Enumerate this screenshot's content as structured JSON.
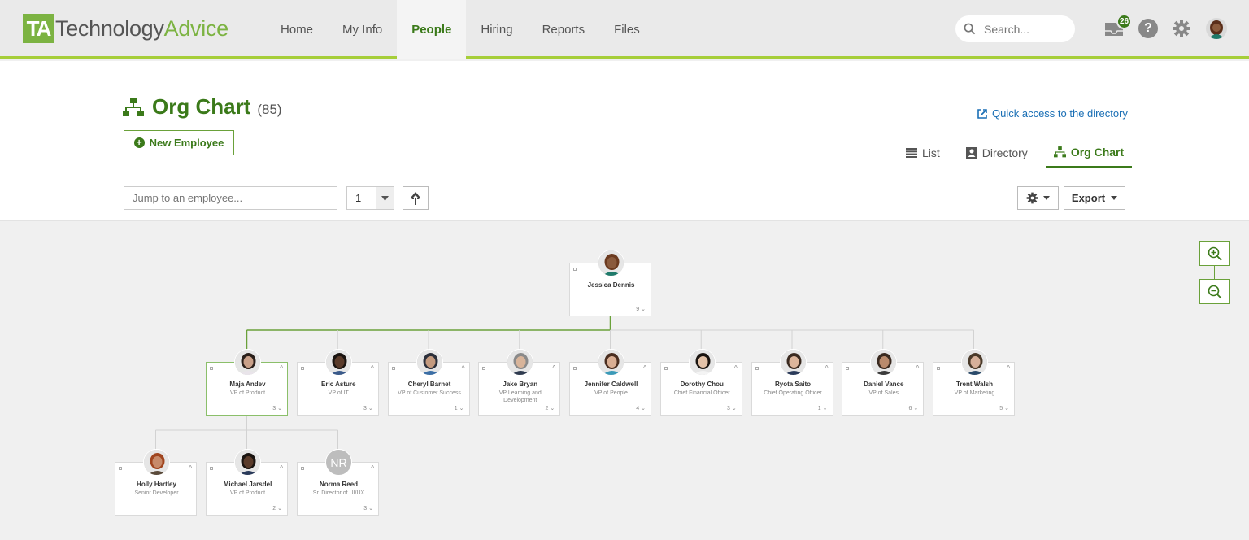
{
  "brand": {
    "mark": "TA",
    "name_a": "Technology",
    "name_b": "Advice"
  },
  "nav": {
    "items": [
      {
        "label": "Home",
        "active": false
      },
      {
        "label": "My Info",
        "active": false
      },
      {
        "label": "People",
        "active": true
      },
      {
        "label": "Hiring",
        "active": false
      },
      {
        "label": "Reports",
        "active": false
      },
      {
        "label": "Files",
        "active": false
      }
    ]
  },
  "search": {
    "placeholder": "Search..."
  },
  "inbox": {
    "badge": "26"
  },
  "help": {
    "label": "?"
  },
  "page": {
    "title": "Org Chart",
    "count": "(85)",
    "quick_access": "Quick access to the directory",
    "new_employee": "New Employee"
  },
  "view_tabs": [
    {
      "label": "List",
      "icon": "list-icon"
    },
    {
      "label": "Directory",
      "icon": "directory-icon"
    },
    {
      "label": "Org Chart",
      "icon": "org-chart-icon",
      "active": true
    }
  ],
  "controls": {
    "jump_placeholder": "Jump to an employee...",
    "level": "1",
    "export": "Export"
  },
  "org": {
    "root": {
      "name": "Jessica Dennis",
      "role": "",
      "count": "9",
      "avatar": {
        "skin": "#8a5a3c",
        "hair": "#6b3a1f",
        "shirt": "#1f7a6a"
      }
    },
    "level1": [
      {
        "name": "Maja Andev",
        "role": "VP of Product",
        "count": "3",
        "highlight": true,
        "avatar": {
          "skin": "#c9a089",
          "hair": "#2a1f1a",
          "shirt": "#e9e4ea"
        }
      },
      {
        "name": "Eric Asture",
        "role": "VP of IT",
        "count": "3",
        "avatar": {
          "skin": "#5a3b2a",
          "hair": "#1a1410",
          "shirt": "#3a5a8a"
        }
      },
      {
        "name": "Cheryl Barnet",
        "role": "VP of Customer Success",
        "count": "1",
        "avatar": {
          "skin": "#c49a7e",
          "hair": "#2b2f3a",
          "shirt": "#3b6ea5"
        }
      },
      {
        "name": "Jake Bryan",
        "role": "VP Learning and Development",
        "count": "2",
        "avatar": {
          "skin": "#d8b49a",
          "hair": "#8a8a8a",
          "shirt": "#2f3b4f"
        }
      },
      {
        "name": "Jennifer Caldwell",
        "role": "VP of People",
        "count": "4",
        "avatar": {
          "skin": "#d9ae93",
          "hair": "#4a2e20",
          "shirt": "#3a9ab8"
        }
      },
      {
        "name": "Dorothy Chou",
        "role": "Chief Financial Officer",
        "count": "3",
        "avatar": {
          "skin": "#e3c2a8",
          "hair": "#1a1410",
          "shirt": "#f4f4f4"
        }
      },
      {
        "name": "Ryota Saito",
        "role": "Chief Operating Officer",
        "count": "1",
        "avatar": {
          "skin": "#dcb59b",
          "hair": "#3a2a20",
          "shirt": "#2a3a5a"
        }
      },
      {
        "name": "Daniel Vance",
        "role": "VP of Sales",
        "count": "6",
        "avatar": {
          "skin": "#b98a6c",
          "hair": "#3a2a20",
          "shirt": "#3a3a3a"
        }
      },
      {
        "name": "Trent Walsh",
        "role": "VP of Marketing",
        "count": "5",
        "avatar": {
          "skin": "#d6b09a",
          "hair": "#4a3a2a",
          "shirt": "#2a4a6a"
        }
      }
    ],
    "level2": [
      {
        "name": "Holly Hartley",
        "role": "Senior Developer",
        "count": "",
        "avatar": {
          "skin": "#c78a6a",
          "hair": "#a0451f",
          "shirt": "#5a4a3a"
        }
      },
      {
        "name": "Michael Jarsdel",
        "role": "VP of Product",
        "count": "2",
        "avatar": {
          "skin": "#5a3b2a",
          "hair": "#1a1410",
          "shirt": "#2a3a5a"
        }
      },
      {
        "name": "Norma Reed",
        "role": "Sr. Director of UI/UX",
        "count": "3",
        "initials": "NR"
      }
    ]
  },
  "colors": {
    "brand_green": "#3b7a1a",
    "accent_lime": "#a6ce39",
    "link_blue": "#1a6fb5"
  }
}
